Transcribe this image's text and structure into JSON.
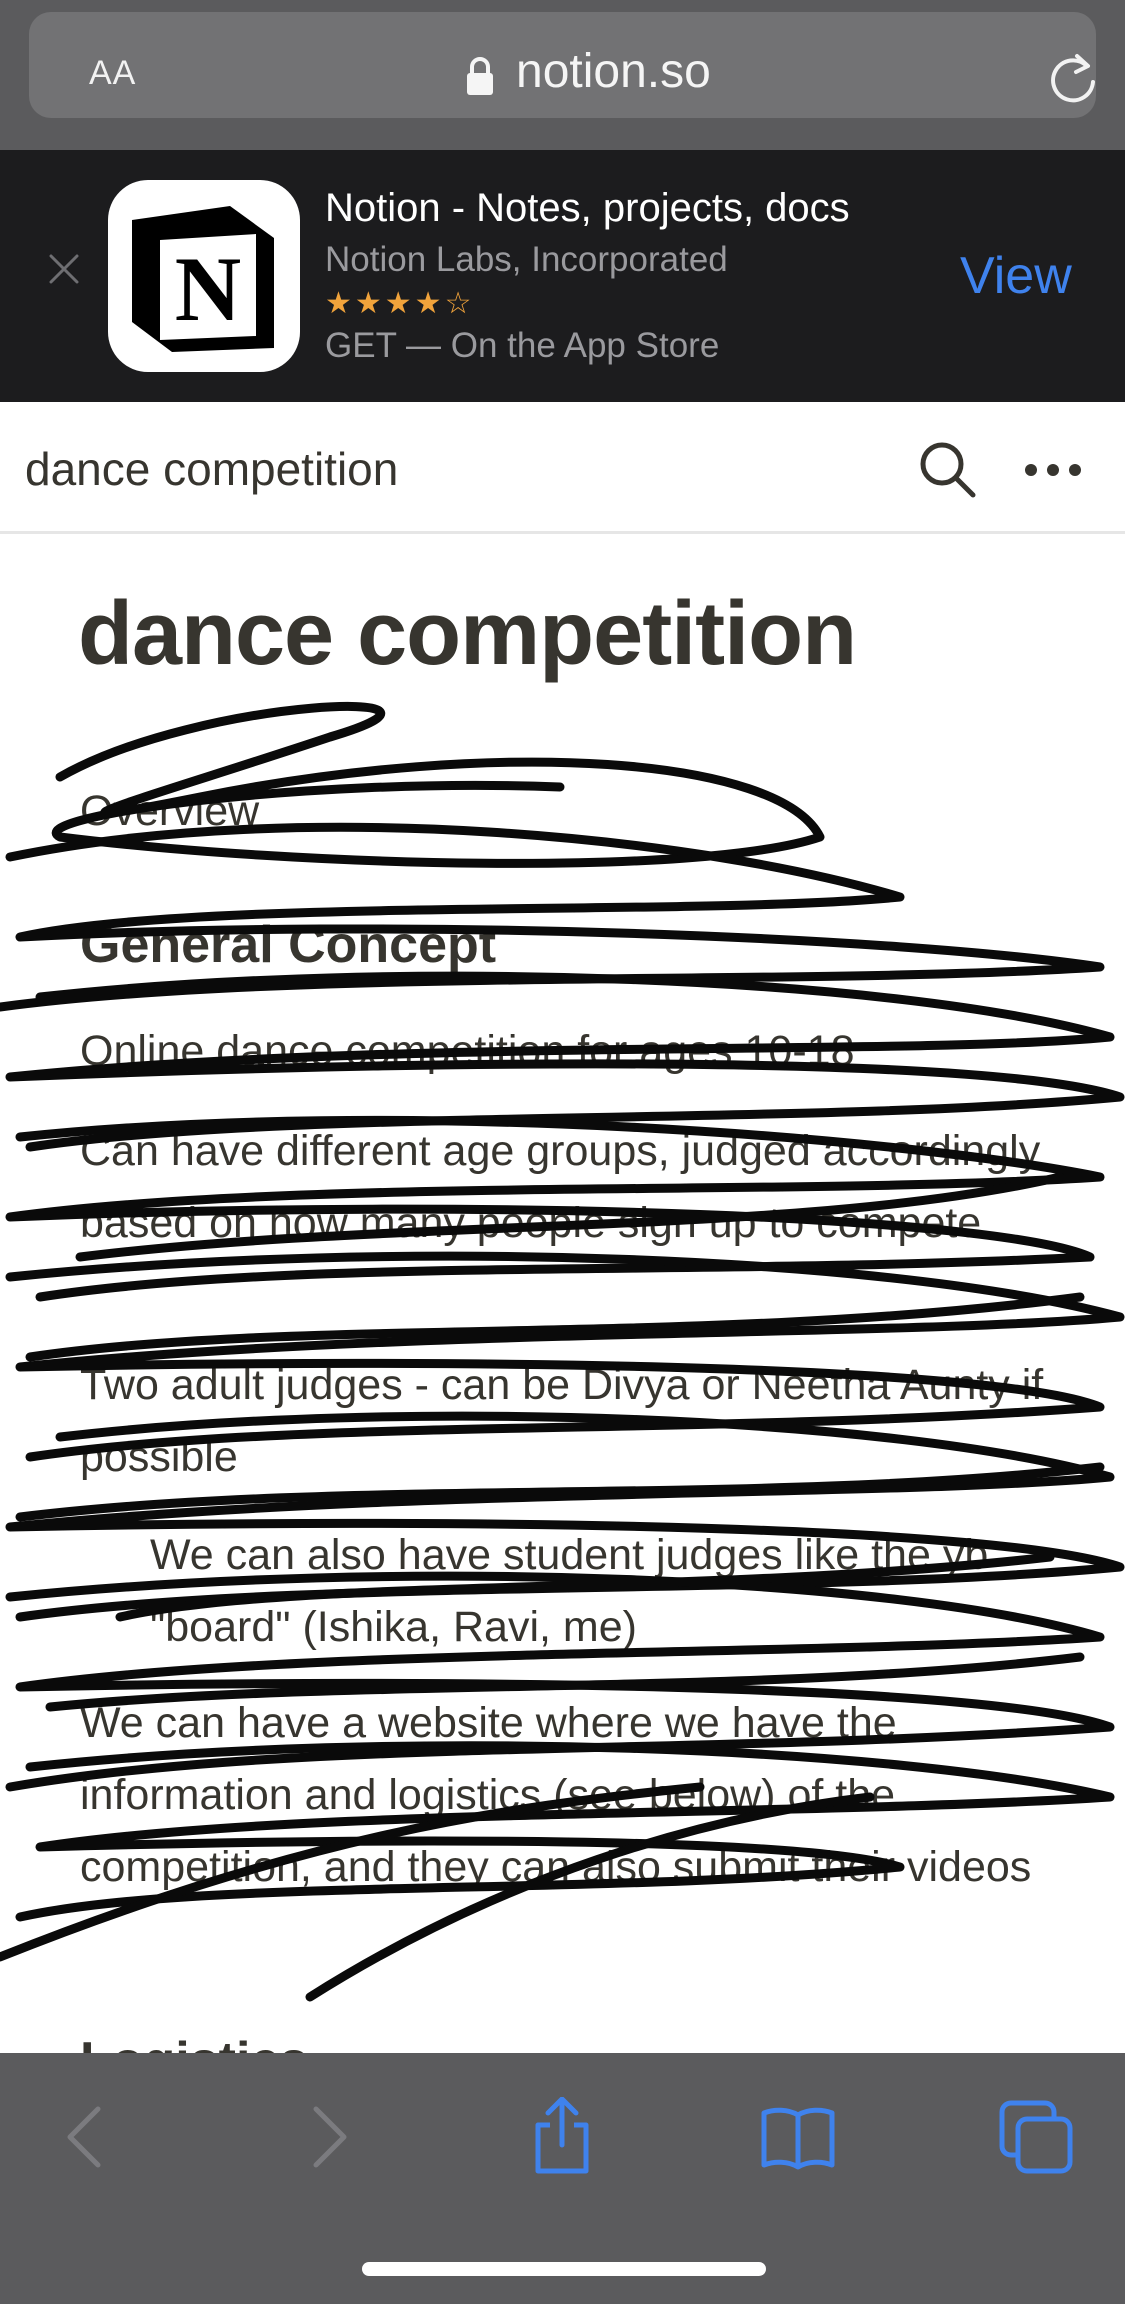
{
  "browser": {
    "text_size_label": "AA",
    "domain": "notion.so"
  },
  "app_banner": {
    "app_name": "Notion - Notes, projects, docs",
    "developer": "Notion Labs, Incorporated",
    "rating": 4.5,
    "rating_max": 5,
    "stars_text": "★★★★☆",
    "get_line": "GET — On the App Store",
    "view_label": "View",
    "icon_letter": "N"
  },
  "notion_bar": {
    "breadcrumb": "dance competition"
  },
  "page": {
    "title": "dance competition",
    "overview": "Overview",
    "concept_heading": "General Concept",
    "paragraphs": [
      "Online dance competition for ages 10-18",
      "Can have different age groups, judged accordingly based on how many people sign up to compete",
      "Two adult judges - can be Divya or Neetha Aunty if possible",
      "We can also have student judges like the yb \"board\" (Ishika, Ravi, me)",
      "We can have a website where we have the information and logistics (see below) of the competition, and they can also submit their videos"
    ],
    "next_heading": "Logistics"
  },
  "colors": {
    "chrome_gray": "#5b5b5d",
    "banner_bg": "#1c1c1e",
    "accent_blue": "#3f82ed",
    "star_orange": "#f1a33b",
    "text_dark": "#37352f"
  },
  "toolbar": {
    "icons": [
      "back-icon",
      "forward-icon",
      "share-icon",
      "bookmarks-icon",
      "tabs-icon"
    ]
  }
}
